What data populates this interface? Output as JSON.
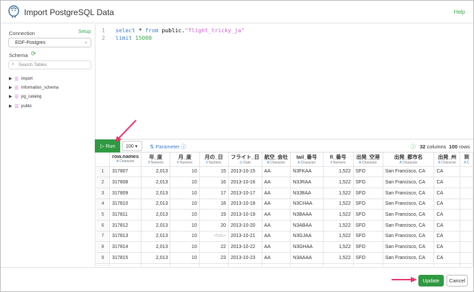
{
  "header": {
    "title": "Import PostgreSQL Data",
    "help_label": "Help"
  },
  "sidebar": {
    "connection_label": "Connection",
    "setup_label": "Setup",
    "connection_value": "EDF-Postgres",
    "schema_label": "Schema",
    "search_placeholder": "Search Tables",
    "schemas": [
      {
        "name": "import"
      },
      {
        "name": "information_schema"
      },
      {
        "name": "pg_catalog"
      },
      {
        "name": "public"
      }
    ]
  },
  "editor": {
    "line_numbers": [
      "1",
      "2"
    ],
    "line1": {
      "kw1": "select",
      "op": " * ",
      "kw2": "from",
      "schema": " public.",
      "table": "\"flight_tricky_ja\""
    },
    "line2": {
      "kw": "limit",
      "num": "15000"
    }
  },
  "toolbar": {
    "run_label": "Run",
    "limit_value": "100",
    "parameter_label": "Parameter",
    "columns_count": "32",
    "columns_label": "columns",
    "rows_count": "100",
    "rows_label": "rows"
  },
  "table": {
    "columns": [
      {
        "name": "",
        "type": "",
        "icon": ""
      },
      {
        "name": "row.names",
        "type": "Character",
        "icon": "A"
      },
      {
        "name": "年_度",
        "type": "Numeric",
        "icon": "#"
      },
      {
        "name": "月_度",
        "type": "Numeric",
        "icon": "#"
      },
      {
        "name": "月の_日",
        "type": "Numeric",
        "icon": "#"
      },
      {
        "name": "フライト_日",
        "type": "Date",
        "icon": "◷"
      },
      {
        "name": "航空_会社",
        "type": "Character",
        "icon": "A"
      },
      {
        "name": "tail_番号",
        "type": "Character",
        "icon": "A"
      },
      {
        "name": "fl_番号",
        "type": "Numeric",
        "icon": "#"
      },
      {
        "name": "出発_空港",
        "type": "Character",
        "icon": "A"
      },
      {
        "name": "出発_都市名",
        "type": "Character",
        "icon": "A"
      },
      {
        "name": "出発_州",
        "type": "Character",
        "icon": "A"
      },
      {
        "name": "到",
        "type": "C",
        "icon": "A"
      }
    ],
    "rows": [
      [
        "1",
        "317807",
        "2,013",
        "10",
        "15",
        "2013-10-15",
        "AA",
        "N3FKAA",
        "1,522",
        "SFO",
        "San Francisco, CA",
        "CA",
        ""
      ],
      [
        "2",
        "317808",
        "2,013",
        "10",
        "16",
        "2013-10-16",
        "AA",
        "N3JRAA",
        "1,522",
        "SFO",
        "San Francisco, CA",
        "CA",
        ""
      ],
      [
        "3",
        "317809",
        "2,013",
        "10",
        "17",
        "2013-10-17",
        "AA",
        "N3JBAA",
        "1,522",
        "SFO",
        "San Francisco, CA",
        "CA",
        ""
      ],
      [
        "4",
        "317810",
        "2,013",
        "10",
        "18",
        "2013-10-18",
        "AA",
        "N3CHAA",
        "1,522",
        "SFO",
        "San Francisco, CA",
        "CA",
        ""
      ],
      [
        "5",
        "317811",
        "2,013",
        "10",
        "19",
        "2013-10-19",
        "AA",
        "N3BAAA",
        "1,522",
        "SFO",
        "San Francisco, CA",
        "CA",
        ""
      ],
      [
        "6",
        "317812",
        "2,013",
        "10",
        "20",
        "2013-10-20",
        "AA",
        "N3ABAA",
        "1,522",
        "SFO",
        "San Francisco, CA",
        "CA",
        ""
      ],
      [
        "7",
        "317813",
        "2,013",
        "10",
        "<NA>",
        "2013-10-21",
        "AA",
        "N3GJAA",
        "1,522",
        "SFO",
        "San Francisco, CA",
        "CA",
        ""
      ],
      [
        "8",
        "317814",
        "2,013",
        "10",
        "22",
        "2013-10-22",
        "AA",
        "N3GHAA",
        "1,522",
        "SFO",
        "San Francisco, CA",
        "CA",
        ""
      ],
      [
        "9",
        "317815",
        "2,013",
        "10",
        "23",
        "2013-10-23",
        "AA",
        "N3AAAA",
        "1,522",
        "SFO",
        "San Francisco, CA",
        "CA",
        ""
      ],
      [
        "10",
        "317816",
        "2,013",
        "10",
        "24",
        "2013-10-24",
        "AA",
        "N3CTAA",
        "1,522",
        "SFO",
        "San Francisco, CA",
        "CA",
        ""
      ]
    ]
  },
  "footer": {
    "update_label": "Update",
    "cancel_label": "Cancel"
  },
  "colors": {
    "accent": "#2f9a41",
    "link": "#3b7ec9",
    "arrow": "#e8336b"
  }
}
